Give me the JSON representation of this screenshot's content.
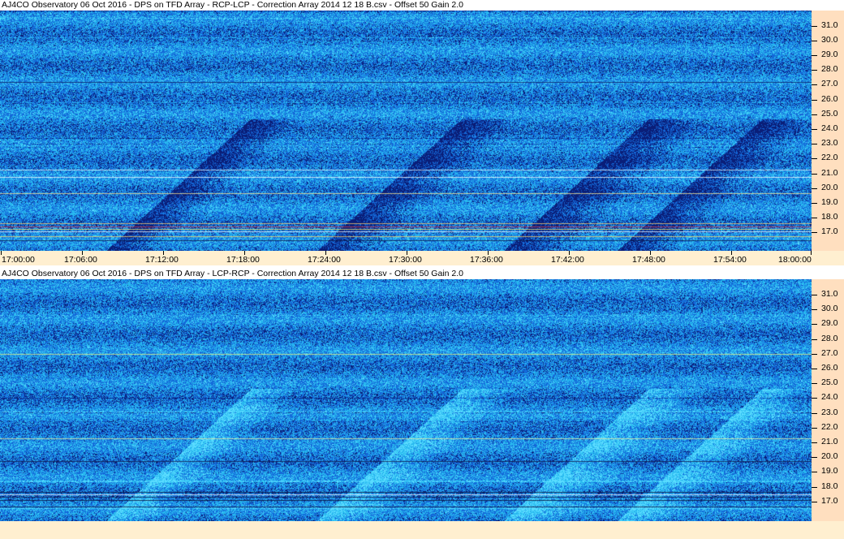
{
  "panels": [
    {
      "id": "top",
      "title": "AJ4CO Observatory 06 Oct 2016 - DPS on TFD Array - RCP-LCP - Correction Array 2014 12 18 B.csv - Offset 50  Gain 2.0",
      "freq_ticks": [
        "31.0",
        "30.0",
        "29.0",
        "28.0",
        "27.0",
        "26.0",
        "25.0",
        "24.0",
        "23.0",
        "22.0",
        "21.0",
        "20.0",
        "19.0",
        "18.0",
        "17.0"
      ],
      "time_ticks": [
        "17:00:00",
        "17:06:00",
        "17:12:00",
        "17:18:00",
        "17:24:00",
        "17:30:00",
        "17:36:00",
        "17:42:00",
        "17:48:00",
        "17:54:00",
        "18:00:00"
      ]
    },
    {
      "id": "bottom",
      "title": "AJ4CO Observatory 06 Oct 2016 - DPS on TFD Array - LCP-RCP - Correction Array 2014 12 18 B.csv - Offset 50  Gain 2.0",
      "freq_ticks": [
        "31.0",
        "30.0",
        "29.0",
        "28.0",
        "27.0",
        "26.0",
        "25.0",
        "24.0",
        "23.0",
        "22.0",
        "21.0",
        "20.0",
        "19.0",
        "18.0",
        "17.0"
      ],
      "time_ticks": []
    }
  ],
  "colors": {
    "plot_base": "#1e66d8",
    "freq_bar": "#ffdfbf",
    "time_bar": "#ffefd0"
  }
}
